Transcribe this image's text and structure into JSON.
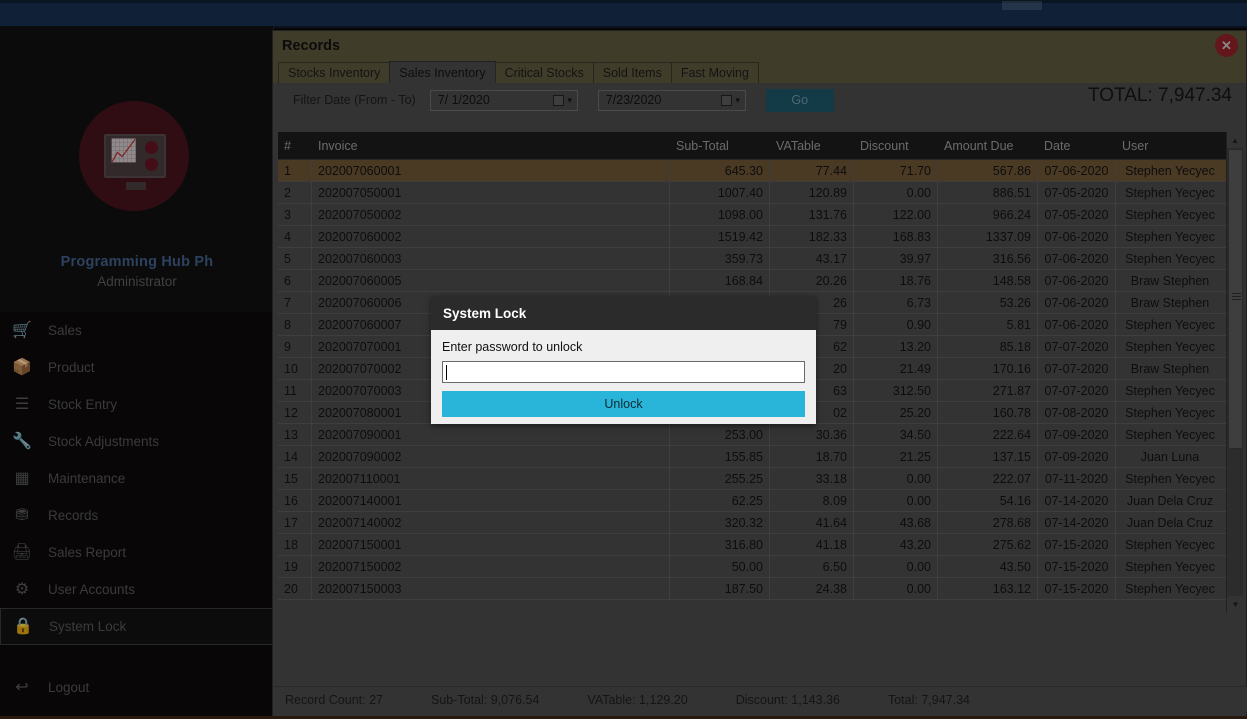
{
  "topbar": {
    "window_control": "minimize-restore"
  },
  "sidebar": {
    "brand": "Programming Hub Ph",
    "role": "Administrator",
    "items": [
      {
        "label": "Sales",
        "icon": "cart-icon",
        "active": false
      },
      {
        "label": "Product",
        "icon": "box-icon",
        "active": false
      },
      {
        "label": "Stock Entry",
        "icon": "list-check-icon",
        "active": false
      },
      {
        "label": "Stock Adjustments",
        "icon": "wrench-icon",
        "active": false
      },
      {
        "label": "Maintenance",
        "icon": "grid-icon",
        "active": false
      },
      {
        "label": "Records",
        "icon": "database-icon",
        "active": false
      },
      {
        "label": "Sales Report",
        "icon": "printer-icon",
        "active": false
      },
      {
        "label": "User Accounts",
        "icon": "gears-icon",
        "active": false
      },
      {
        "label": "System Lock",
        "icon": "lock-icon",
        "active": true
      },
      {
        "label": "Logout",
        "icon": "logout-icon",
        "active": false
      }
    ]
  },
  "window": {
    "title": "Records",
    "close_icon": "close-icon",
    "tabs": [
      {
        "label": "Stocks Inventory",
        "active": false
      },
      {
        "label": "Sales Inventory",
        "active": true
      },
      {
        "label": "Critical Stocks",
        "active": false
      },
      {
        "label": "Sold Items",
        "active": false
      },
      {
        "label": "Fast Moving",
        "active": false
      }
    ],
    "filter": {
      "label": "Filter Date (From - To)",
      "date_from": "7/ 1/2020",
      "date_to": "7/23/2020",
      "go_label": "Go",
      "calendar_icon": "calendar-icon",
      "caret_icon": "chevron-down-icon"
    },
    "total_display": "TOTAL: 7,947.34"
  },
  "grid": {
    "columns": [
      "#",
      "Invoice",
      "Sub-Total",
      "VATable",
      "Discount",
      "Amount Due",
      "Date",
      "User"
    ],
    "selected_row_index": 0,
    "rows": [
      {
        "n": "1",
        "invoice": "202007060001",
        "sub": "645.30",
        "vat": "77.44",
        "dis": "71.70",
        "amt": "567.86",
        "date": "07-06-2020",
        "user": "Stephen Yecyec"
      },
      {
        "n": "2",
        "invoice": "202007050001",
        "sub": "1007.40",
        "vat": "120.89",
        "dis": "0.00",
        "amt": "886.51",
        "date": "07-05-2020",
        "user": "Stephen Yecyec"
      },
      {
        "n": "3",
        "invoice": "202007050002",
        "sub": "1098.00",
        "vat": "131.76",
        "dis": "122.00",
        "amt": "966.24",
        "date": "07-05-2020",
        "user": "Stephen Yecyec"
      },
      {
        "n": "4",
        "invoice": "202007060002",
        "sub": "1519.42",
        "vat": "182.33",
        "dis": "168.83",
        "amt": "1337.09",
        "date": "07-06-2020",
        "user": "Stephen Yecyec"
      },
      {
        "n": "5",
        "invoice": "202007060003",
        "sub": "359.73",
        "vat": "43.17",
        "dis": "39.97",
        "amt": "316.56",
        "date": "07-06-2020",
        "user": "Stephen Yecyec"
      },
      {
        "n": "6",
        "invoice": "202007060005",
        "sub": "168.84",
        "vat": "20.26",
        "dis": "18.76",
        "amt": "148.58",
        "date": "07-06-2020",
        "user": "Braw Stephen"
      },
      {
        "n": "7",
        "invoice": "202007060006",
        "sub": "",
        "vat": "26",
        "dis": "6.73",
        "amt": "53.26",
        "date": "07-06-2020",
        "user": "Braw Stephen"
      },
      {
        "n": "8",
        "invoice": "202007060007",
        "sub": "",
        "vat": "79",
        "dis": "0.90",
        "amt": "5.81",
        "date": "07-06-2020",
        "user": "Stephen Yecyec"
      },
      {
        "n": "9",
        "invoice": "202007070001",
        "sub": "",
        "vat": "62",
        "dis": "13.20",
        "amt": "85.18",
        "date": "07-07-2020",
        "user": "Stephen Yecyec"
      },
      {
        "n": "10",
        "invoice": "202007070002",
        "sub": "",
        "vat": "20",
        "dis": "21.49",
        "amt": "170.16",
        "date": "07-07-2020",
        "user": "Braw Stephen"
      },
      {
        "n": "11",
        "invoice": "202007070003",
        "sub": "",
        "vat": "63",
        "dis": "312.50",
        "amt": "271.87",
        "date": "07-07-2020",
        "user": "Stephen Yecyec"
      },
      {
        "n": "12",
        "invoice": "202007080001",
        "sub": "",
        "vat": "02",
        "dis": "25.20",
        "amt": "160.78",
        "date": "07-08-2020",
        "user": "Stephen Yecyec"
      },
      {
        "n": "13",
        "invoice": "202007090001",
        "sub": "253.00",
        "vat": "30.36",
        "dis": "34.50",
        "amt": "222.64",
        "date": "07-09-2020",
        "user": "Stephen Yecyec"
      },
      {
        "n": "14",
        "invoice": "202007090002",
        "sub": "155.85",
        "vat": "18.70",
        "dis": "21.25",
        "amt": "137.15",
        "date": "07-09-2020",
        "user": "Juan Luna"
      },
      {
        "n": "15",
        "invoice": "202007110001",
        "sub": "255.25",
        "vat": "33.18",
        "dis": "0.00",
        "amt": "222.07",
        "date": "07-11-2020",
        "user": "Stephen Yecyec"
      },
      {
        "n": "16",
        "invoice": "202007140001",
        "sub": "62.25",
        "vat": "8.09",
        "dis": "0.00",
        "amt": "54.16",
        "date": "07-14-2020",
        "user": "Juan Dela Cruz"
      },
      {
        "n": "17",
        "invoice": "202007140002",
        "sub": "320.32",
        "vat": "41.64",
        "dis": "43.68",
        "amt": "278.68",
        "date": "07-14-2020",
        "user": "Juan Dela Cruz"
      },
      {
        "n": "18",
        "invoice": "202007150001",
        "sub": "316.80",
        "vat": "41.18",
        "dis": "43.20",
        "amt": "275.62",
        "date": "07-15-2020",
        "user": "Stephen Yecyec"
      },
      {
        "n": "19",
        "invoice": "202007150002",
        "sub": "50.00",
        "vat": "6.50",
        "dis": "0.00",
        "amt": "43.50",
        "date": "07-15-2020",
        "user": "Stephen Yecyec"
      },
      {
        "n": "20",
        "invoice": "202007150003",
        "sub": "187.50",
        "vat": "24.38",
        "dis": "0.00",
        "amt": "163.12",
        "date": "07-15-2020",
        "user": "Stephen Yecyec"
      }
    ]
  },
  "statusbar": {
    "record_count": "Record Count: 27",
    "sub_total": "Sub-Total: 9,076.54",
    "vatable": "VATable: 1,129.20",
    "discount": "Discount: 1,143.36",
    "total": "Total: 7,947.34"
  },
  "modal": {
    "title": "System Lock",
    "prompt": "Enter password to unlock",
    "password_value": "",
    "password_placeholder": "",
    "unlock_label": "Unlock",
    "accent_color": "#29b4da"
  },
  "colors": {
    "topbar": "#17304f",
    "window_title": "#5c563d",
    "selected_row": "#6b5434",
    "accent": "#29b4da",
    "logo": "#6d1526"
  }
}
